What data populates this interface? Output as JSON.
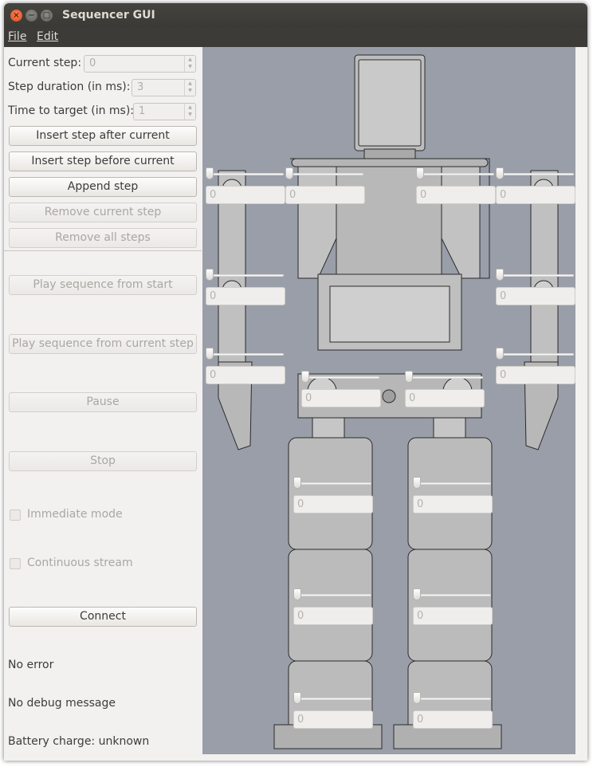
{
  "window": {
    "title": "Sequencer GUI"
  },
  "menu": [
    "File",
    "Edit"
  ],
  "fields": [
    {
      "label": "Current step:",
      "value": "0"
    },
    {
      "label": "Step duration (in ms):",
      "value": "3"
    },
    {
      "label": "Time to target (in ms):",
      "value": "1"
    }
  ],
  "buttons": {
    "insert_after": "Insert step after current",
    "insert_before": "Insert step before current",
    "append": "Append step",
    "remove_current": "Remove current step",
    "remove_all": "Remove all steps",
    "play_start": "Play sequence from start",
    "play_current": "Play sequence from current step",
    "pause": "Pause",
    "stop": "Stop",
    "connect": "Connect"
  },
  "checkboxes": {
    "immediate": "Immediate mode",
    "continuous": "Continuous stream"
  },
  "status": {
    "error": "No error",
    "debug": "No debug message",
    "battery": "Battery charge: unknown"
  },
  "servos": [
    {
      "value": "0"
    },
    {
      "value": "0"
    },
    {
      "value": "0"
    },
    {
      "value": "0"
    },
    {
      "value": "0"
    },
    {
      "value": "0"
    },
    {
      "value": "0"
    },
    {
      "value": "0"
    },
    {
      "value": "0"
    },
    {
      "value": "0"
    },
    {
      "value": "0"
    },
    {
      "value": "0"
    },
    {
      "value": "0"
    },
    {
      "value": "0"
    },
    {
      "value": "0"
    },
    {
      "value": "0"
    }
  ],
  "colors": {
    "titlebar": "#3c3b37",
    "panel": "#f2f1f0",
    "canvas": "#999ea8",
    "close_button": "#e95420"
  }
}
